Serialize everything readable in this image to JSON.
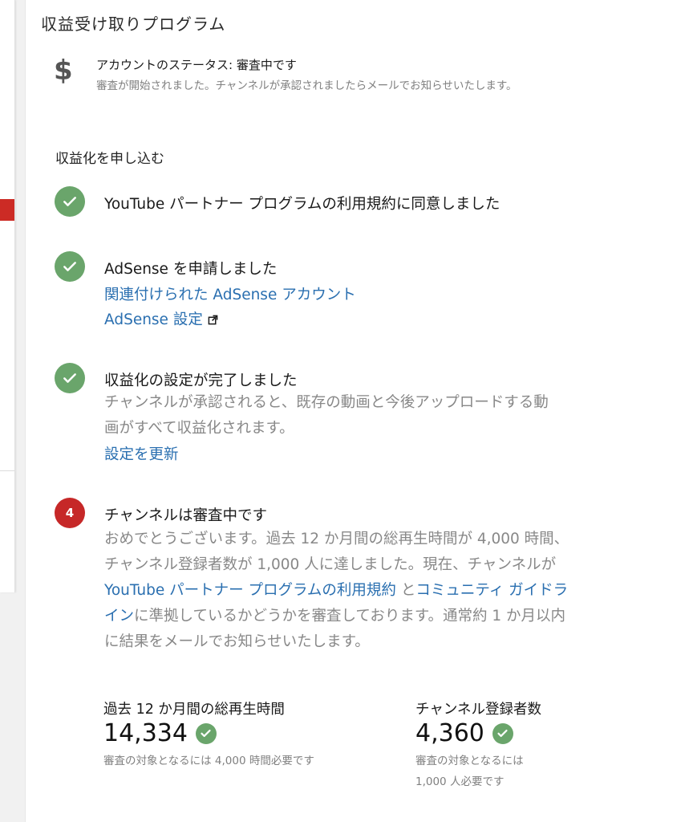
{
  "page": {
    "title": "収益受け取りプログラム"
  },
  "account_status": {
    "icon": "dollar-icon",
    "title": "アカウントのステータス: 審査中です",
    "description": "審査が開始されました。チャンネルが承認されましたらメールでお知らせいたします。"
  },
  "apply": {
    "section_title": "収益化を申し込む",
    "step1": {
      "title": "YouTube パートナー プログラムの利用規約に同意しました"
    },
    "step2": {
      "title": "AdSense を申請しました",
      "link_account": "関連付けられた AdSense アカウント",
      "link_settings": "AdSense 設定"
    },
    "step3": {
      "title": "収益化の設定が完了しました",
      "description": "チャンネルが承認されると、既存の動画と今後アップロードする動画がすべて収益化されます。",
      "link_update": "設定を更新"
    },
    "step4": {
      "number": "4",
      "title": "チャンネルは審査中です",
      "desc_part1": "おめでとうございます。過去 12 か月間の総再生時間が 4,000 時間、チャンネル登録者数が 1,000 人に達しました。現在、チャンネルが ",
      "link_terms": "YouTube パートナー プログラムの利用規約",
      "desc_part2": " と",
      "link_guidelines": "コミュニティ ガイドライン",
      "desc_part3": "に準拠しているかどうかを審査しております。通常約 1 か月以内に結果をメールでお知らせいたします。"
    }
  },
  "metrics": {
    "watch_time": {
      "label": "過去 12 か月間の総再生時間",
      "value": "14,334",
      "note": "審査の対象となるには 4,000 時間必要です"
    },
    "subscribers": {
      "label": "チャンネル登録者数",
      "value": "4,360",
      "note": "審査の対象となるには 1,000 人必要です"
    }
  },
  "colors": {
    "check_green": "#6aa56b",
    "step_red": "#c62828",
    "link_blue": "#2a6fb0"
  }
}
